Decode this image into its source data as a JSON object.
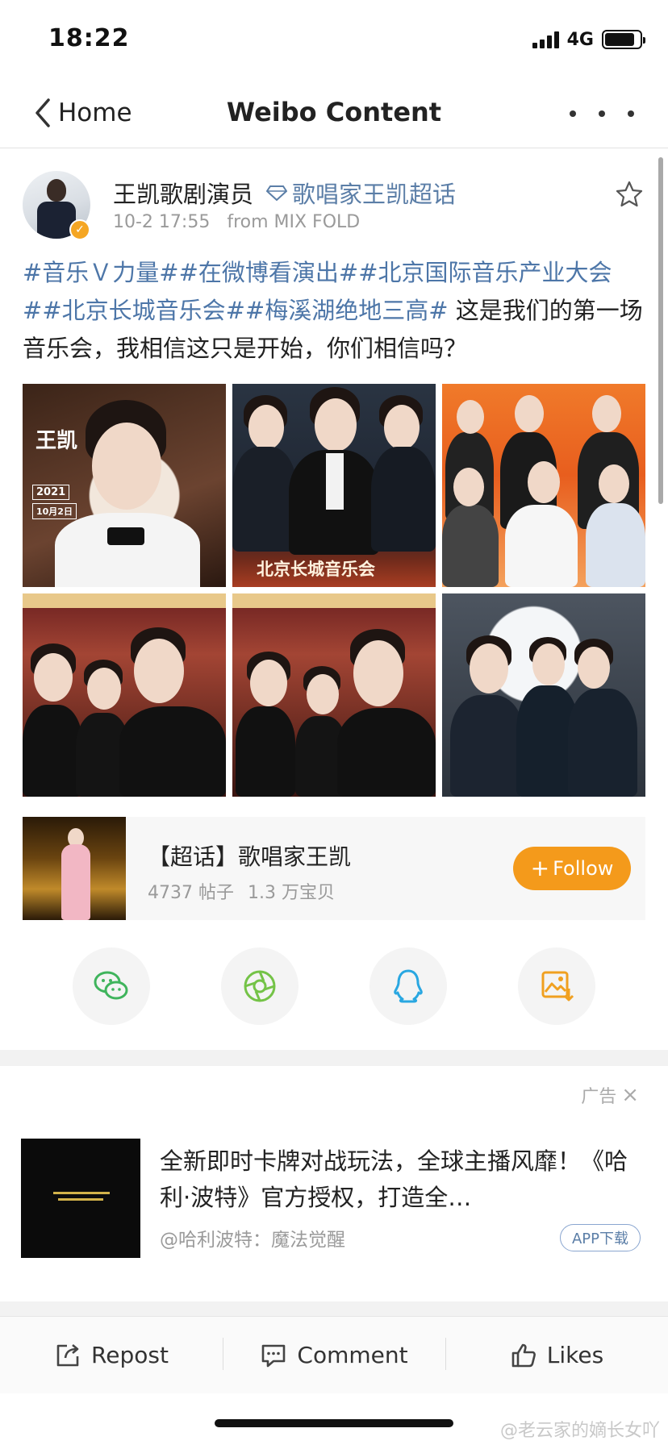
{
  "status_bar": {
    "time": "18:22",
    "network": "4G",
    "battery_percent": 85
  },
  "nav": {
    "back_label": "Home",
    "title": "Weibo Content"
  },
  "post": {
    "user_name": "王凯歌剧演员",
    "supertopic_tag": "歌唱家王凯超话",
    "time": "10-2 17:55",
    "source": "from MIX FOLD",
    "hashtags": [
      "#音乐Ｖ力量#",
      "#在微博看演出#",
      "#北京国际音乐产业大会#",
      "#北京长城音乐会#",
      "#梅溪湖绝地三高#"
    ],
    "text": " 这是我们的第一场音乐会，我相信这只是开始，你们相信吗？",
    "image_captions": {
      "img1_name": "王凯",
      "img1_date_year": "2021",
      "img1_date_day": "10月2日",
      "img2_bottom": "北京长城音乐会"
    }
  },
  "supertopic_card": {
    "title": "【超话】歌唱家王凯",
    "posts": "4737 帖子",
    "fans": "1.3 万宝贝",
    "follow_label": "Follow"
  },
  "share": {
    "icons": [
      "wechat-icon",
      "moments-icon",
      "qq-icon",
      "save-image-icon"
    ]
  },
  "ad": {
    "label": "广告",
    "title": "全新即时卡牌对战玩法，全球主播风靡！《哈利·波特》官方授权，打造全…",
    "source": "@哈利波特：魔法觉醒",
    "download_label": "APP下载"
  },
  "actions": {
    "repost": "Repost",
    "comment": "Comment",
    "likes": "Likes"
  },
  "watermark": "@老云家的嫡长女吖",
  "colors": {
    "link": "#4d76a8",
    "follow": "#f49a1b",
    "verified": "#f5a623"
  }
}
